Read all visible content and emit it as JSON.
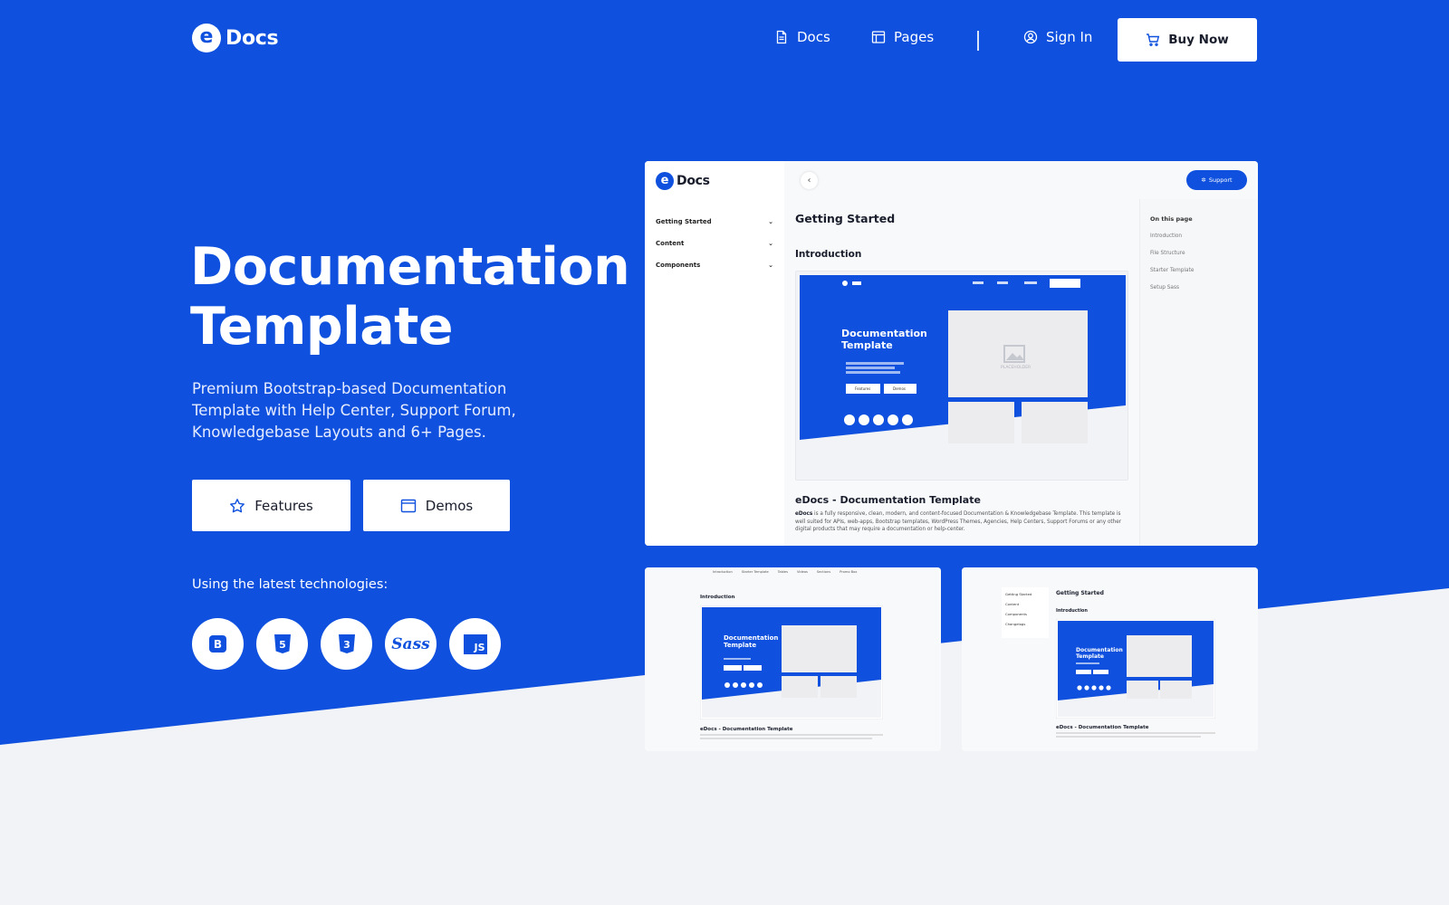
{
  "brand": {
    "logo_letter": "e",
    "name": "Docs"
  },
  "nav": {
    "docs_label": "Docs",
    "pages_label": "Pages",
    "signin_label": "Sign In",
    "buy_label": "Buy Now"
  },
  "hero": {
    "title_line1": "Documentation",
    "title_line2": "Template",
    "subtitle": "Premium Bootstrap-based Documentation Template with Help Center, Support Forum, Knowledgebase Layouts and 6+ Pages.",
    "features_label": "Features",
    "demos_label": "Demos",
    "tech_label": "Using the latest technologies:",
    "tech_icons": {
      "bootstrap": "B",
      "html5": "5",
      "css3": "3",
      "sass": "Sass",
      "js": "JS"
    }
  },
  "colors": {
    "primary": "#0f51de",
    "background_light": "#f2f3f6",
    "white": "#ffffff"
  },
  "preview": {
    "brand_name": "Docs",
    "support_label": "Support",
    "sidebar": [
      "Getting Started",
      "Content",
      "Components"
    ],
    "page_title": "Getting Started",
    "section_title": "Introduction",
    "toc_heading": "On this page",
    "toc": [
      "Introduction",
      "File Structure",
      "Starter Template",
      "Setup Sass"
    ],
    "article_title": "eDocs - Documentation Template",
    "article_lead": "eDocs",
    "article_body": " is a fully responsive, clean, modern, and content-focused Documentation & Knowledgebase Template. This template is well suited for APIs, web-apps, Bootstrap templates, WordPress Themes, Agencies, Help Centers, Support Forums or any other digital products that may require a documentation or help-center.",
    "mini_title_line1": "Documentation",
    "mini_title_line2": "Template",
    "mini_features": "Features",
    "mini_demos": "Demos",
    "placeholder_label": "PLACEHOLDER"
  },
  "thumb_left": {
    "tabs": [
      "Introduction",
      "Starter Template",
      "Tables",
      "Videos",
      "Sections",
      "Promo Box"
    ],
    "section_title": "Introduction",
    "article_title": "eDocs - Documentation Template"
  },
  "thumb_right": {
    "sidebar": [
      "Getting Started",
      "Content",
      "Components",
      "Changelogs"
    ],
    "page_title": "Getting Started",
    "section_title": "Introduction",
    "article_title": "eDocs - Documentation Template"
  }
}
